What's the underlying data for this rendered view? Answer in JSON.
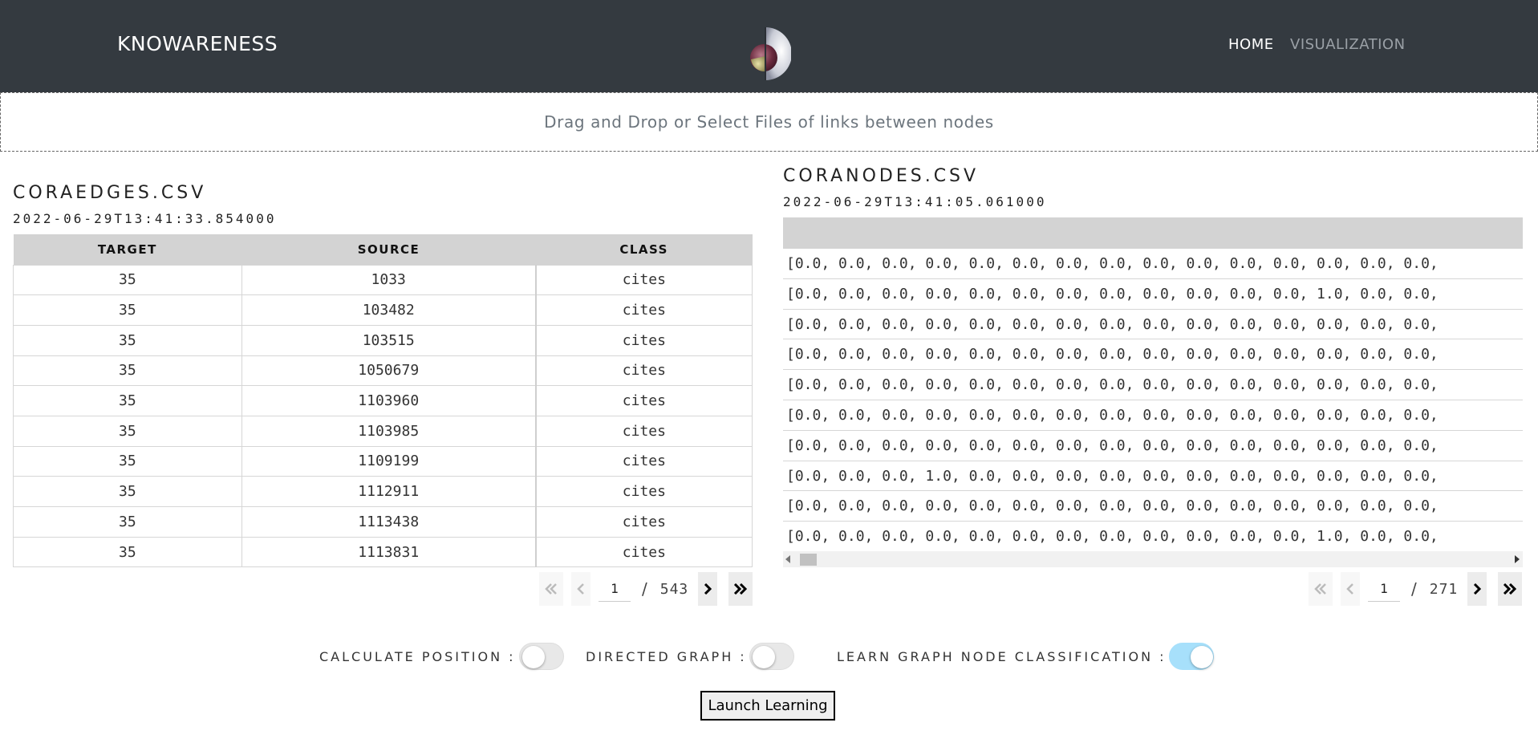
{
  "header": {
    "brand": "KNOWARENESS",
    "nav": {
      "home": "HOME",
      "visualization": "VISUALIZATION"
    }
  },
  "dropzone": {
    "text": "Drag and Drop or Select Files of links between nodes"
  },
  "edges_file": {
    "title": "CORAEDGES.CSV",
    "date": "2022-06-29T13:41:33.854000",
    "columns": [
      "TARGET",
      "SOURCE",
      "CLASS"
    ],
    "rows": [
      [
        "35",
        "1033",
        "cites"
      ],
      [
        "35",
        "103482",
        "cites"
      ],
      [
        "35",
        "103515",
        "cites"
      ],
      [
        "35",
        "1050679",
        "cites"
      ],
      [
        "35",
        "1103960",
        "cites"
      ],
      [
        "35",
        "1103985",
        "cites"
      ],
      [
        "35",
        "1109199",
        "cites"
      ],
      [
        "35",
        "1112911",
        "cites"
      ],
      [
        "35",
        "1113438",
        "cites"
      ],
      [
        "35",
        "1113831",
        "cites"
      ]
    ],
    "pagination": {
      "page": "1",
      "separator": "/",
      "total": "543"
    }
  },
  "nodes_file": {
    "title": "CORANODES.CSV",
    "date": "2022-06-29T13:41:05.061000",
    "rows": [
      "[0.0, 0.0, 0.0, 0.0, 0.0, 0.0, 0.0, 0.0, 0.0, 0.0, 0.0, 0.0, 0.0, 0.0, 0.0,",
      "[0.0, 0.0, 0.0, 0.0, 0.0, 0.0, 0.0, 0.0, 0.0, 0.0, 0.0, 0.0, 1.0, 0.0, 0.0,",
      "[0.0, 0.0, 0.0, 0.0, 0.0, 0.0, 0.0, 0.0, 0.0, 0.0, 0.0, 0.0, 0.0, 0.0, 0.0,",
      "[0.0, 0.0, 0.0, 0.0, 0.0, 0.0, 0.0, 0.0, 0.0, 0.0, 0.0, 0.0, 0.0, 0.0, 0.0,",
      "[0.0, 0.0, 0.0, 0.0, 0.0, 0.0, 0.0, 0.0, 0.0, 0.0, 0.0, 0.0, 0.0, 0.0, 0.0,",
      "[0.0, 0.0, 0.0, 0.0, 0.0, 0.0, 0.0, 0.0, 0.0, 0.0, 0.0, 0.0, 0.0, 0.0, 0.0,",
      "[0.0, 0.0, 0.0, 0.0, 0.0, 0.0, 0.0, 0.0, 0.0, 0.0, 0.0, 0.0, 0.0, 0.0, 0.0,",
      "[0.0, 0.0, 0.0, 1.0, 0.0, 0.0, 0.0, 0.0, 0.0, 0.0, 0.0, 0.0, 0.0, 0.0, 0.0,",
      "[0.0, 0.0, 0.0, 0.0, 0.0, 0.0, 0.0, 0.0, 0.0, 0.0, 0.0, 0.0, 0.0, 0.0, 0.0,",
      "[0.0, 0.0, 0.0, 0.0, 0.0, 0.0, 0.0, 0.0, 0.0, 0.0, 0.0, 0.0, 1.0, 0.0, 0.0,"
    ],
    "pagination": {
      "page": "1",
      "separator": "/",
      "total": "271"
    }
  },
  "options": {
    "calculate_position": {
      "label": "CALCULATE POSITION :",
      "checked": false
    },
    "directed_graph": {
      "label": "DIRECTED GRAPH :",
      "checked": false
    },
    "learn_classification": {
      "label": "LEARN GRAPH NODE CLASSIFICATION :",
      "checked": true
    }
  },
  "launch_button": "Launch Learning",
  "colors": {
    "navbar": "#343a40",
    "toggle_on": "#a7e0fb",
    "table_header": "#d3d3d3"
  },
  "icons": {
    "first_page": "double-chevron-left-icon",
    "prev_page": "chevron-left-icon",
    "next_page": "chevron-right-icon",
    "last_page": "double-chevron-right-icon"
  }
}
